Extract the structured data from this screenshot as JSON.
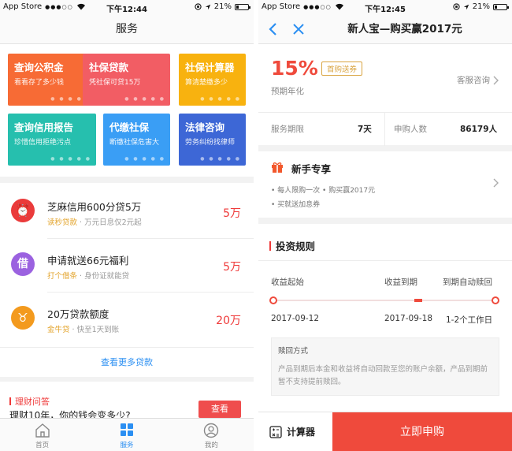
{
  "status_left": {
    "carrier": "App Store",
    "signal_dots": "●●●○○",
    "time": "下午12:44",
    "battery": "21%"
  },
  "status_right": {
    "carrier": "App Store",
    "signal_dots": "●●●○○",
    "time": "下午12:45",
    "battery": "21%"
  },
  "services": {
    "title": "服务",
    "tiles": [
      {
        "title": "查询公积金",
        "sub": "看看存了多少钱",
        "color": "#f76b35"
      },
      {
        "title": "社保贷款",
        "sub": "凭社保可贷15万",
        "color": "#f25d64"
      },
      {
        "title": "社保计算器",
        "sub": "算清楚缴多少",
        "color": "#f8b20f"
      },
      {
        "title": "查询信用报告",
        "sub": "珍惜信用拒绝污点",
        "color": "#26bfae"
      },
      {
        "title": "代缴社保",
        "sub": "断缴社保危害大",
        "color": "#3a9ef5"
      },
      {
        "title": "法律咨询",
        "sub": "劳务纠纷找律师",
        "color": "#3d67d6"
      }
    ],
    "loans": [
      {
        "title": "芝麻信用600分贷5万",
        "tag": "读秒贷款",
        "desc": "· 万元日息仅2元起",
        "amount": "5万",
        "icon_char": "⏰",
        "icon_color": "#ea3b3b"
      },
      {
        "title": "申请就送66元福利",
        "tag": "打个借条",
        "desc": "· 身份证就能贷",
        "amount": "5万",
        "icon_char": "借",
        "icon_color": "#9b62e0"
      },
      {
        "title": "20万贷款额度",
        "tag": "金牛贷",
        "desc": "· 快至1天到账",
        "amount": "20万",
        "icon_char": "♉",
        "icon_color": "#f39a1e"
      }
    ],
    "more_loans": "查看更多贷款",
    "finance": {
      "title": "理财问答",
      "question": "理财10年，你的钱会变多少?",
      "button": "查看"
    },
    "tabs": [
      {
        "label": "首页"
      },
      {
        "label": "服务"
      },
      {
        "label": "我的"
      }
    ]
  },
  "product": {
    "title": "新人宝—购买赢2017元",
    "rate": "15%",
    "badge": "首购送券",
    "rate_label": "预期年化",
    "service": "客服咨询",
    "period_label": "服务期限",
    "period_value": "7天",
    "buyers_label": "申购人数",
    "buyers_value": "86179人",
    "newbie": {
      "title": "新手专享",
      "line1": "• 每人限购一次  • 购买赢2017元",
      "line2": "• 买就送加息券"
    },
    "rules": {
      "title": "投资规则",
      "start_label": "收益起始",
      "end_label": "收益到期",
      "redeem_label": "到期自动赎回",
      "start_date": "2017-09-12",
      "end_date": "2017-09-18",
      "redeem_time": "1-2个工作日",
      "redeem_method_title": "赎回方式",
      "redeem_method_text": "产品到期后本金和收益将自动回款至您的账户余额，产品到期前暂不支持提前赎回。"
    },
    "calculator": "计算器",
    "apply": "立即申购"
  }
}
